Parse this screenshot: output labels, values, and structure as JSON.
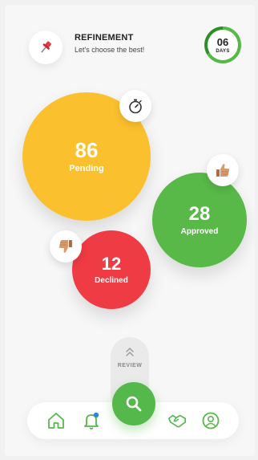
{
  "header": {
    "title": "REFINEMENT",
    "subtitle": "Let's choose the best!",
    "days_value": "06",
    "days_label": "DAYS"
  },
  "stats": {
    "pending": {
      "value": "86",
      "label": "Pending"
    },
    "approved": {
      "value": "28",
      "label": "Approved"
    },
    "declined": {
      "value": "12",
      "label": "Declined"
    }
  },
  "review": {
    "label": "REVIEW"
  },
  "icons": {
    "header": "pin-icon",
    "pending": "stopwatch-icon",
    "approved": "thumbs-up-icon",
    "declined": "thumbs-down-icon",
    "review": "chevrons-up-icon",
    "fab": "search-icon",
    "nav": [
      "home-icon",
      "bell-icon",
      "handshake-icon",
      "user-icon"
    ]
  },
  "colors": {
    "pending": "#fbc02d",
    "approved": "#58b848",
    "declined": "#ef3b44",
    "accent": "#55b84a",
    "notification_dot": "#2e86de"
  }
}
